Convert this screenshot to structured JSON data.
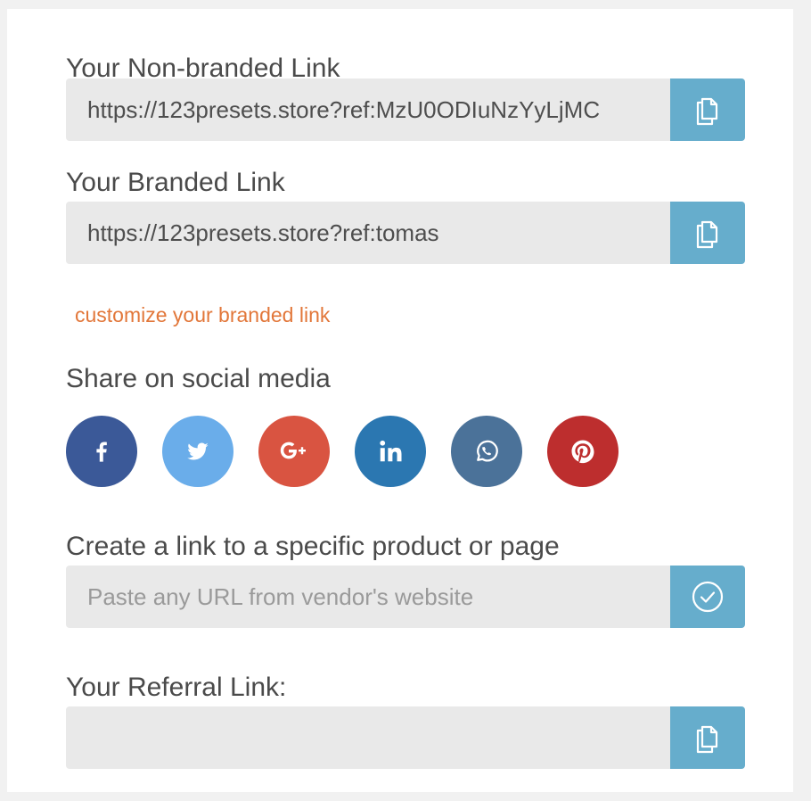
{
  "non_branded": {
    "label": "Your Non-branded Link",
    "value": "https://123presets.store?ref:MzU0ODIuNzYyLjMC"
  },
  "branded": {
    "label": "Your Branded Link",
    "value": "https://123presets.store?ref:tomas",
    "customize_link": "customize your branded link"
  },
  "social": {
    "label": "Share on social media",
    "items": [
      {
        "name": "facebook",
        "icon": "facebook-icon",
        "color": "#3b5998"
      },
      {
        "name": "twitter",
        "icon": "twitter-icon",
        "color": "#6aadea"
      },
      {
        "name": "google-plus",
        "icon": "google-plus-icon",
        "color": "#d95441"
      },
      {
        "name": "linkedin",
        "icon": "linkedin-icon",
        "color": "#2b77b1"
      },
      {
        "name": "whatsapp",
        "icon": "whatsapp-icon",
        "color": "#4b7299"
      },
      {
        "name": "pinterest",
        "icon": "pinterest-icon",
        "color": "#bd2e2e"
      }
    ]
  },
  "product_link": {
    "label": "Create a link to a specific product or page",
    "placeholder": "Paste any URL from vendor's website",
    "value": ""
  },
  "referral": {
    "label": "Your Referral Link:",
    "value": ""
  },
  "colors": {
    "accent": "#66adcc",
    "link": "#e2773a",
    "field_bg": "#e9e9e9",
    "label": "#4a4a4a"
  }
}
